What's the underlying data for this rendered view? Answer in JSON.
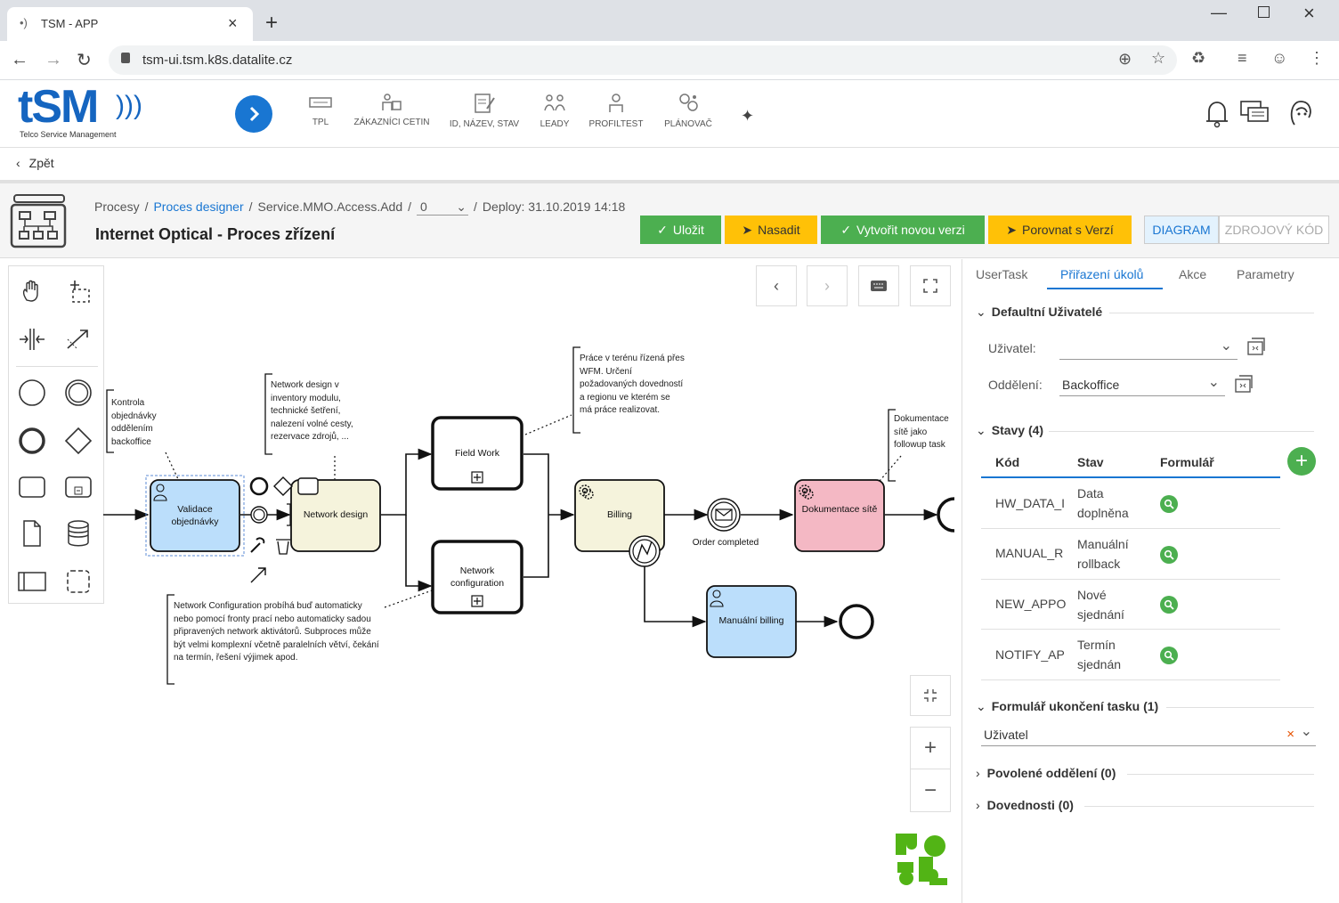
{
  "browser": {
    "tab_title": "TSM - APP",
    "url": "tsm-ui.tsm.k8s.datalite.cz"
  },
  "app": {
    "logo_text": "tSM",
    "logo_sub": "Telco Service Management",
    "nav": [
      {
        "label": "TPL",
        "icon": "ticket-icon"
      },
      {
        "label": "ZÁKAZNÍCI CETIN",
        "icon": "customers-icon"
      },
      {
        "label": "ID, NÁZEV, STAV",
        "icon": "document-edit-icon"
      },
      {
        "label": "LEADY",
        "icon": "leads-icon"
      },
      {
        "label": "PROFILTEST",
        "icon": "person-icon"
      },
      {
        "label": "PLÁNOVAČ",
        "icon": "planner-icon"
      }
    ],
    "back_label": "Zpět"
  },
  "breadcrumb": {
    "items": [
      "Procesy",
      "Proces designer",
      "Service.MMO.Access.Add"
    ],
    "version": "0",
    "deploy": "Deploy: 31.10.2019 14:18",
    "title": "Internet Optical - Proces zřízení"
  },
  "actions": {
    "save": "Uložit",
    "deploy": "Nasadit",
    "new_version": "Vytvořit novou verzi",
    "compare": "Porovnat s Verzí",
    "diagram": "DIAGRAM",
    "source": "ZDROJOVÝ KÓD"
  },
  "diagram": {
    "tasks": {
      "validace": "Validace objednávky",
      "network_design": "Network design",
      "field_work": "Field Work",
      "network_config": "Network configuration",
      "billing": "Billing",
      "dokumentace": "Dokumentace sítě",
      "manualni_billing": "Manuální billing"
    },
    "event_label": "Order completed",
    "notes": {
      "kontrola": "Kontrola objednávky oddělením backoffice",
      "network_design": "Network design v inventory modulu, technické šetření, nalezení volné cesty, rezervace zdrojů, ...",
      "prace": "Práce v terénu řízená přes WFM. Určení požadovaných dovedností a regionu ve kterém se má práce realizovat.",
      "dokumentace": "Dokumentace sítě jako followup task",
      "network_config": "Network Configuration probíhá buď automaticky nebo pomocí fronty prací nebo automaticky sadou připravených network aktivátorů. Subproces může být velmi komplexní včetně paralelních větví, čekání na termín, řešení výjimek apod."
    }
  },
  "panel": {
    "tabs": [
      "UserTask",
      "Přiřazení úkolů",
      "Akce",
      "Parametry"
    ],
    "active_tab": "Přiřazení úkolů",
    "default_users": {
      "title": "Defaultní Uživatelé",
      "user_label": "Uživatel:",
      "user_value": "",
      "dept_label": "Oddělení:",
      "dept_value": "Backoffice"
    },
    "states": {
      "title": "Stavy (4)",
      "headers": [
        "Kód",
        "Stav",
        "Formulář"
      ],
      "rows": [
        {
          "code": "HW_DATA_I",
          "state1": "Data",
          "state2": "doplněna"
        },
        {
          "code": "MANUAL_R",
          "state1": "Manuální",
          "state2": "rollback"
        },
        {
          "code": "NEW_APPO",
          "state1": "Nové",
          "state2": "sjednání"
        },
        {
          "code": "NOTIFY_AP",
          "state1": "Termín",
          "state2": "sjednán"
        }
      ]
    },
    "finish_form": {
      "title": "Formulář ukončení tasku (1)",
      "value": "Uživatel"
    },
    "allowed_depts": "Povolené oddělení (0)",
    "skills": "Dovednosti (0)"
  },
  "colors": {
    "accent": "#1976d2",
    "green": "#4caf50",
    "yellow": "#ffc107",
    "task_blue": "#bbdefb",
    "task_beige": "#f5f3dc",
    "task_pink": "#f4b8c4"
  }
}
